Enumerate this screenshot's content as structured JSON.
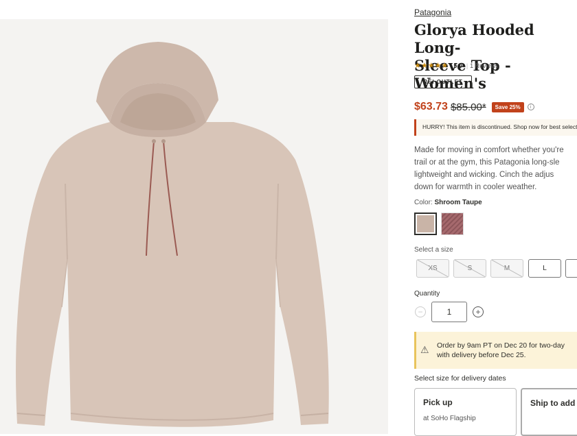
{
  "product": {
    "brand": "Patagonia",
    "title_line1": "Glorya Hooded Long-",
    "title_line2": "Sleeve Top - Women's",
    "rating": "5.0",
    "stars": "★★★★★",
    "reviews": "1 Reviews",
    "badge": "REI OUTLET",
    "image_color": "#d7c3b6"
  },
  "pricing": {
    "sale": "$63.73",
    "original": "$85.00*",
    "save": "Save 25%",
    "info_icon": "info-icon",
    "sale_color": "#c1421b"
  },
  "notice": {
    "hurry": "HURRY! This item is discontinued. Shop now for best selection."
  },
  "description": {
    "lines": [
      "Made for moving in comfort whether you're",
      "trail or at the gym, this Patagonia long-sle",
      "lightweight and wicking. Cinch the adjus",
      "down for warmth in cooler weather."
    ]
  },
  "color": {
    "label": "Color:",
    "selected": "Shroom Taupe"
  },
  "size": {
    "label": "Select a size",
    "options": [
      "XS",
      "S",
      "M",
      "L"
    ]
  },
  "quantity": {
    "label": "Quantity",
    "value": "1",
    "minus": "−",
    "plus": "+"
  },
  "order": {
    "line1": "Order by 9am PT on Dec 20 for two-day",
    "line2": "with delivery before Dec 25.",
    "icon": "⚠"
  },
  "delivery": {
    "label": "Select size for delivery dates",
    "pickup_title": "Pick up",
    "pickup_sub": "at SoHo Flagship",
    "ship_title": "Ship to add"
  }
}
